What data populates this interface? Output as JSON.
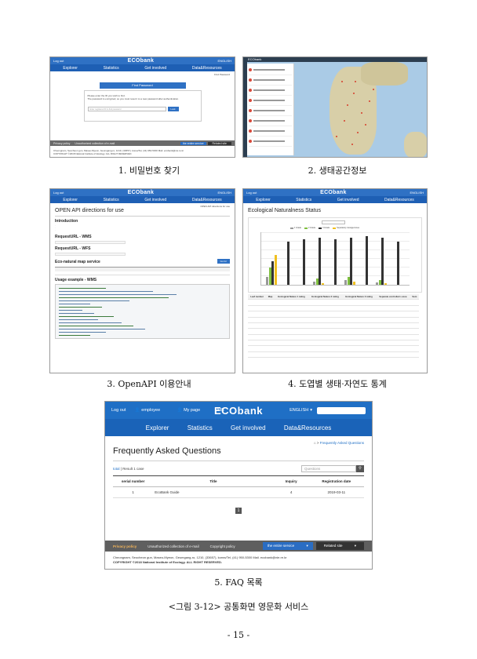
{
  "captions": {
    "c1": "1. 비밀번호 찾기",
    "c2": "2. 생태공간정보",
    "c3": "3. OpenAPI 이용안내",
    "c4": "4. 도엽별 생태·자연도 통계",
    "c5": "5. FAQ 목록"
  },
  "figure_caption": "<그림 3-12> 공통화면 영문화 서비스",
  "page_number": "- 15 -",
  "site": {
    "logo": "ECObank",
    "nav": [
      "Explorer",
      "Statistics",
      "Get involved",
      "Data&Resources"
    ],
    "top_links": [
      "Log out",
      "employee",
      "My page",
      "NIE"
    ],
    "lang": "ENGLISH"
  },
  "shot1": {
    "banner": "Find Password",
    "crumb": "Find Password",
    "msg1": "Please enter the ID you wish to find.",
    "msg2": "The password is encrypted, so you must reset it to a new password after authentication.",
    "input_placeholder": "Enter registered ID to find password",
    "button": "Look"
  },
  "shot3": {
    "crumb": "OPEN API directions for use",
    "title": "OPEN API directions for use",
    "intro": "Introduction",
    "h_wms": "RequestURL - WMS",
    "h_wfs": "RequestURL - WFS",
    "h_eco": "Eco-natural map service",
    "h_usage": "Usage example - WMS",
    "btn_go": "Go for"
  },
  "shot4": {
    "title": "Ecological Naturalness Status",
    "legend": [
      "1 Grade",
      "2 Grade",
      "3 Grade",
      "Separately managed area"
    ],
    "table_head": [
      "Leaf number",
      "Map",
      "Ecological Nature 1 rating",
      "Ecological Nature 2 rating",
      "Ecological Nature 3 rating",
      "Separate controlled s area",
      "Sum"
    ]
  },
  "shot5": {
    "top_links": [
      "Log out",
      "employee",
      "My page",
      "NIE"
    ],
    "lang": "ENGLISH",
    "crumb": "Frequently Asked Questions",
    "title": "Frequently Asked Questions",
    "total_label": "total",
    "result_label": "Result 1 case",
    "search_placeholder": "Questions",
    "columns": [
      "serial number",
      "Title",
      "Inquiry",
      "Registration date"
    ],
    "rows": [
      {
        "num": "1",
        "title": "EcoBank Guide",
        "inquiry": "4",
        "date": "2019-03-11"
      }
    ],
    "page": "1",
    "footer_links": [
      "Privacy policy",
      "Unauthorized collection of e-mail",
      "Copyright policy"
    ],
    "btn_entire": "the entire service",
    "btn_related": "Related site",
    "address": "Cheongnam, Seocheon gun, Maseo-Myeon, Geumgang-ro, 1210, (33657),    korea/Tel, (41) 950-5300    Mail. ecobank@nie.re.kr",
    "copyright": "COPYRIGHT ©2018 National Institute of Ecology. ALL RIGHT RESERVED."
  },
  "colors": {
    "primary": "#1f6fc5",
    "nav": "#1a63b8",
    "footer": "#5f5f5f",
    "bar_grade1": "#999999",
    "bar_grade2": "#7fbf3f",
    "bar_grade3": "#333333",
    "bar_separate": "#f0c020"
  }
}
